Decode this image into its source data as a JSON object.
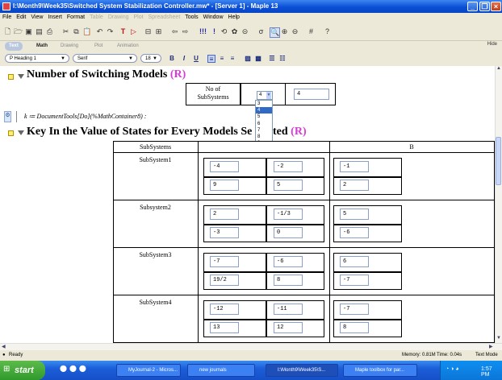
{
  "window": {
    "title": "I:\\Month9\\Week35\\Switched System Stabilization Controller.mw* - [Server 1] - Maple 13"
  },
  "menu": [
    "File",
    "Edit",
    "View",
    "Insert",
    "Format",
    "Table",
    "Drawing",
    "Plot",
    "Spreadsheet",
    "Tools",
    "Window",
    "Help"
  ],
  "menu_disabled": [
    "Table",
    "Drawing",
    "Plot",
    "Spreadsheet"
  ],
  "context_tabs": [
    "Text",
    "Math",
    "Drawing",
    "Plot",
    "Animation"
  ],
  "hide_label": "Hide",
  "format": {
    "style": "P Heading 1",
    "font": "Serif",
    "size": "18",
    "bold": "B",
    "italic": "I",
    "underline": "U"
  },
  "section1": {
    "title": "Number of Switching Models ",
    "r": "(R)"
  },
  "switching": {
    "label": "No of SubSystems",
    "value": "4",
    "result": "4",
    "options": [
      "3",
      "4",
      "5",
      "6",
      "7",
      "8",
      "9",
      "10"
    ],
    "selected": "4"
  },
  "math": {
    "line": "k ≔ DocumentTools[Do](%MathContainer8) :"
  },
  "section2": {
    "title": "Key In the Value of States for Every Models Se",
    "title2": "ted ",
    "r": "(R)"
  },
  "table": {
    "headers": [
      "SubSystems",
      "",
      "B"
    ],
    "rows": [
      {
        "name": "SubSystem1",
        "A": [
          [
            "-4",
            "-2"
          ],
          [
            "9",
            "5"
          ]
        ],
        "B": [
          "-1",
          "2"
        ]
      },
      {
        "name": "Subsystem2",
        "A": [
          [
            "2",
            "-1/3"
          ],
          [
            "-3",
            "0"
          ]
        ],
        "B": [
          "5",
          "-6"
        ]
      },
      {
        "name": "SubSystem3",
        "A": [
          [
            "-7",
            "-6"
          ],
          [
            "19/2",
            "8"
          ]
        ],
        "B": [
          "6",
          "-7"
        ]
      },
      {
        "name": "SubSystem4",
        "A": [
          [
            "-12",
            "-11"
          ],
          [
            "13",
            "12"
          ]
        ],
        "B": [
          "-7",
          "8"
        ]
      }
    ]
  },
  "status": {
    "ready": "Ready",
    "memory": "Memory: 0.81M",
    "time": "Time: 0.04s",
    "mode": "Text Mode"
  },
  "taskbar": {
    "start": "start",
    "tasks": [
      "MyJournal-2 - Micros...",
      "new journals",
      "I:\\Month9\\Week35\\S...",
      "Maple toolbox for par..."
    ],
    "clock": "1:57 PM"
  },
  "colors": {
    "titlebar": "#0a4fd6",
    "heading_r": "#d63bd6",
    "selection": "#316ac5",
    "section_bullet": "#ffef73"
  }
}
